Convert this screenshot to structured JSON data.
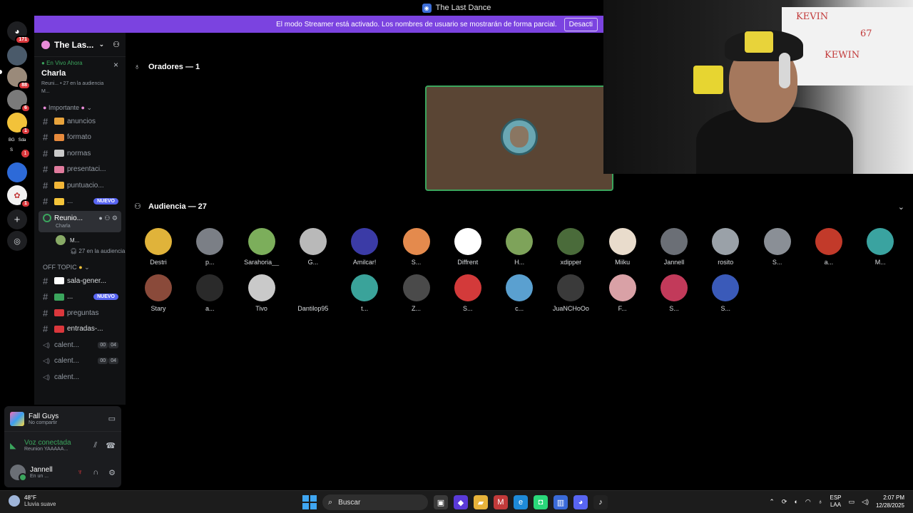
{
  "window": {
    "title": "The Last Dance"
  },
  "banner": {
    "text": "El modo Streamer está activado. Los nombres de usuario se mostrarán de forma parcial.",
    "button": "Desacti"
  },
  "rail": {
    "home_badge": "171",
    "badges": [
      "88",
      "6",
      "1",
      "1",
      "1"
    ],
    "folder_label_1": "BG",
    "folder_label_2": "Sda",
    "folder_label_3": "S"
  },
  "server": {
    "name": "The Las..."
  },
  "live": {
    "label": "En Vivo Ahora",
    "stage": "Charla",
    "sub": "Reuni... • 27 en la audiencia",
    "member": "M..."
  },
  "categories": {
    "importante": "Importante",
    "offtopic": "OFF TOPIC"
  },
  "channels": [
    {
      "label": "anuncios",
      "emo": "#e8a33c"
    },
    {
      "label": "formato",
      "emo": "#e88a3c"
    },
    {
      "label": "normas",
      "emo": "#c9c9c9"
    },
    {
      "label": "presentaci...",
      "emo": "#e07b9d"
    },
    {
      "label": "puntuacio...",
      "emo": "#f2b637"
    },
    {
      "label": "...",
      "emo": "#f4c43a",
      "badge": "NUEVO"
    }
  ],
  "voice_active": {
    "name": "Reunio...",
    "sub": "Charla"
  },
  "participant": {
    "name": "M...",
    "audience": "27 en la audiencia"
  },
  "channels2": [
    {
      "label": "sala-gener...",
      "emo": "#ffffff"
    },
    {
      "label": "...",
      "emo": "#3ba55d",
      "badge": "NUEVO"
    },
    {
      "label": "preguntas",
      "emo": "#da373c"
    },
    {
      "label": "entradas-...",
      "emo": "#da373c"
    }
  ],
  "voice_channels": [
    {
      "label": "calent...",
      "c1": "00",
      "c2": "04"
    },
    {
      "label": "calent...",
      "c1": "00",
      "c2": "04"
    },
    {
      "label": "calent...",
      "c1": "",
      "c2": ""
    }
  ],
  "panel": {
    "game": "Fall Guys",
    "game_sub": "No compartir",
    "conn": "Voz conectada",
    "conn_sub": "Reunion YAAAAA...",
    "user": "Jannell",
    "user_status": "En un ..."
  },
  "stage": {
    "speakers_label": "Oradores — 1",
    "audience_label": "Audiencia — 27"
  },
  "audience": [
    {
      "name": "Destri",
      "color": "#e0b33a"
    },
    {
      "name": "p...",
      "color": "#7b7f86"
    },
    {
      "name": "Sarahoria__",
      "color": "#7cae5b"
    },
    {
      "name": "G...",
      "color": "#b9b9b9"
    },
    {
      "name": "Amilcar!",
      "color": "#3b3ba6"
    },
    {
      "name": "S...",
      "color": "#e48a4d"
    },
    {
      "name": "Diffrent",
      "color": "#ffffff"
    },
    {
      "name": "H...",
      "color": "#7ea35a"
    },
    {
      "name": "xdipper",
      "color": "#4a6b3a"
    },
    {
      "name": "Miiku",
      "color": "#e9dccc"
    },
    {
      "name": "Jannell",
      "color": "#6b6f76"
    },
    {
      "name": "rosito",
      "color": "#9aa1a8"
    },
    {
      "name": "S...",
      "color": "#8a8f96"
    },
    {
      "name": "a...",
      "color": "#c23a2a"
    },
    {
      "name": "M...",
      "color": "#3aa3a0"
    },
    {
      "name": "Stary",
      "color": "#8a4a3a"
    },
    {
      "name": "a...",
      "color": "#2a2a2a"
    },
    {
      "name": "Tivo",
      "color": "#c9c9c9"
    },
    {
      "name": "Dantilop95",
      "color": "#000000"
    },
    {
      "name": "t...",
      "color": "#3aa39a"
    },
    {
      "name": "Z...",
      "color": "#4a4a4a"
    },
    {
      "name": "S...",
      "color": "#d33a3a"
    },
    {
      "name": "c...",
      "color": "#5aa0d0"
    },
    {
      "name": "JuaNCHoOo",
      "color": "#3a3a3a"
    },
    {
      "name": "F...",
      "color": "#d9a1a6"
    },
    {
      "name": "S...",
      "color": "#c23a5a"
    },
    {
      "name": "S...",
      "color": "#3a5ab9"
    }
  ],
  "taskbar": {
    "temp": "48°F",
    "weather": "Lluvia suave",
    "search": "Buscar",
    "lang1": "ESP",
    "lang2": "LAA",
    "time": "2:07 PM",
    "date": "12/28/2025"
  }
}
